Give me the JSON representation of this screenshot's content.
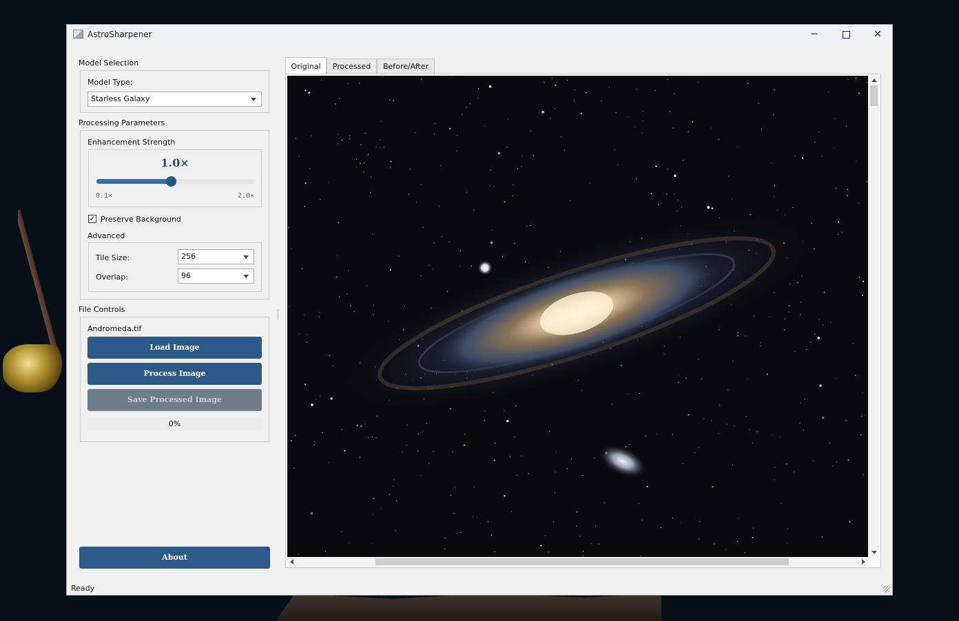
{
  "window": {
    "title": "AstroSharpener"
  },
  "window_controls": {
    "minimize": "─",
    "close": "✕"
  },
  "model_selection": {
    "section_title": "Model Selection",
    "model_type_label": "Model Type:",
    "model_type_value": "Starless Galaxy"
  },
  "processing": {
    "section_title": "Processing Parameters",
    "strength_label": "Enhancement Strength",
    "strength_display": "1.0×",
    "strength_value": 1.0,
    "strength_min": 0.1,
    "strength_max": 2.0,
    "strength_min_label": "0.1×",
    "strength_max_label": "2.0×",
    "preserve_background_label": "Preserve Background",
    "preserve_background_checked": true,
    "check_mark": "✓",
    "advanced_label": "Advanced",
    "tile_size_label": "Tile Size:",
    "tile_size_value": "256",
    "overlap_label": "Overlap:",
    "overlap_value": "96"
  },
  "file_controls": {
    "section_title": "File Controls",
    "file_name": "Andromeda.tif",
    "load_button": "Load Image",
    "process_button": "Process Image",
    "save_button": "Save Processed Image",
    "progress_text": "0%",
    "progress_value": 0
  },
  "about_button": "About",
  "tabs": [
    {
      "label": "Original",
      "active": true
    },
    {
      "label": "Processed",
      "active": false
    },
    {
      "label": "Before/After",
      "active": false
    }
  ],
  "status_bar": {
    "text": "Ready"
  },
  "colors": {
    "accent": "#2b5988",
    "disabled_button": "#6e7b89",
    "strength_text": "#2b4d74"
  },
  "icons": {
    "app": "app-window-icon",
    "dropdown": "chevron-down-icon",
    "scroll_up": "scroll-up-arrow-icon",
    "scroll_down": "scroll-down-arrow-icon",
    "scroll_left": "scroll-left-arrow-icon",
    "scroll_right": "scroll-right-arrow-icon"
  }
}
